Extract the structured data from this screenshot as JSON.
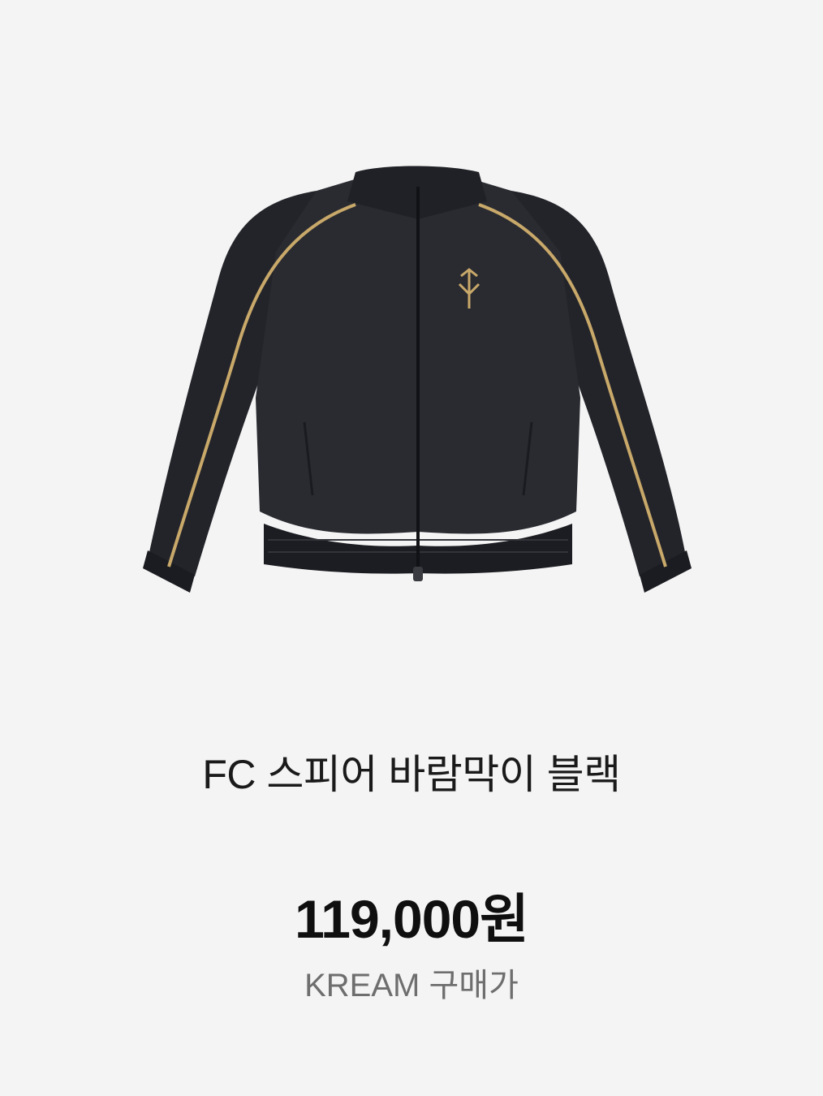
{
  "product": {
    "image_alt": "jacket-photo",
    "name": "FC 스피어 바람막이 블랙",
    "price": "119,000원",
    "price_label": "KREAM 구매가"
  },
  "colors": {
    "background": "#f4f4f4",
    "jacket": "#25262b",
    "piping": "#c9a96a"
  }
}
